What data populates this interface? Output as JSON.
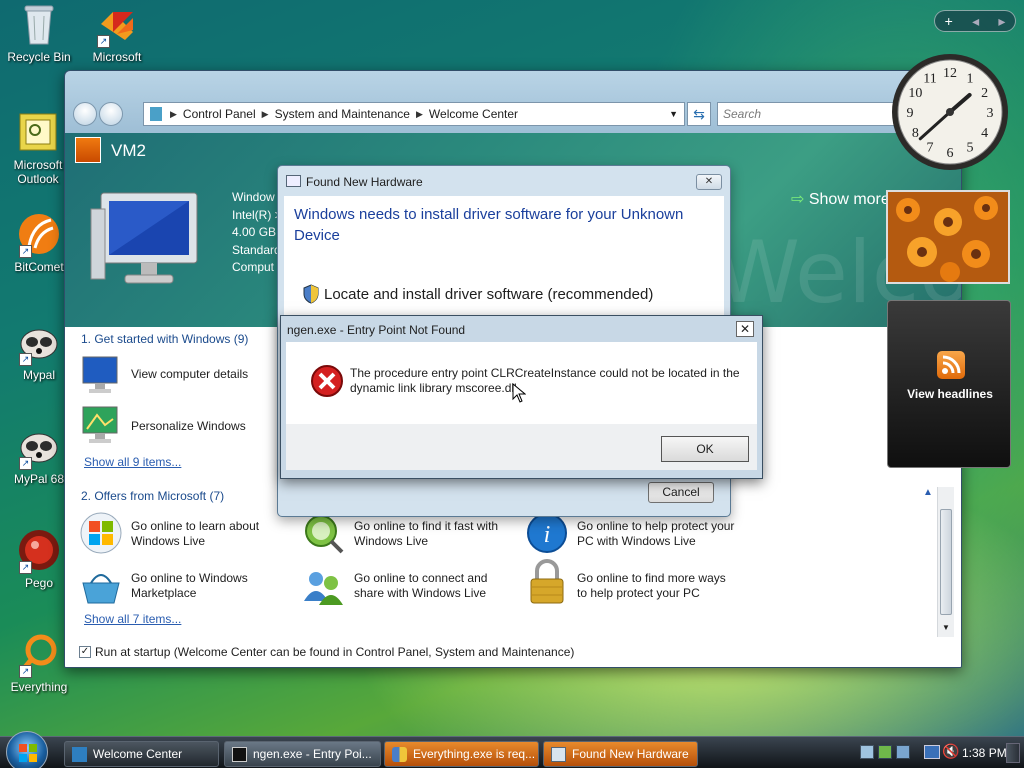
{
  "desktop": {
    "icons": [
      {
        "label": "Recycle Bin"
      },
      {
        "label": "Microsoft"
      },
      {
        "label": "Microsoft Outlook"
      },
      {
        "label": "BitComet"
      },
      {
        "label": "Mypal"
      },
      {
        "label": "MyPal 68"
      },
      {
        "label": "Pego"
      },
      {
        "label": "Everything"
      }
    ]
  },
  "window": {
    "breadcrumb": [
      "Control Panel",
      "System and Maintenance",
      "Welcome Center"
    ],
    "search_placeholder": "Search",
    "computer_name": "VM2",
    "system_info": "Window\nIntel(R) >\n4.00 GB I\nStandard\nComput",
    "show_more": "Show more",
    "banner_watermark": "Welcome",
    "section1": {
      "header": "1. Get started with Windows (9)",
      "items": [
        "View computer details",
        "Personalize Windows"
      ],
      "show_all": "Show all 9 items..."
    },
    "section2": {
      "header": "2. Offers from Microsoft (7)",
      "items": [
        "Go online to learn about Windows Live",
        "Go online to find it fast with Windows Live",
        "Go online to help protect your PC with Windows Live",
        "Go online to Windows Marketplace",
        "Go online to connect and share with Windows Live",
        "Go online to find more ways to help protect your PC"
      ],
      "show_all": "Show all 7 items..."
    },
    "startup_label": "Run at startup (Welcome Center can be found in Control Panel, System and Maintenance)",
    "startup_checked": true
  },
  "found_new_hardware": {
    "title": "Found New Hardware",
    "heading": "Windows needs to install driver software for your Unknown Device",
    "option": "Locate and install driver software (recommended)",
    "cancel": "Cancel"
  },
  "error_dialog": {
    "title": "ngen.exe - Entry Point Not Found",
    "message": "The procedure entry point CLRCreateInstance could not be located in the dynamic link library mscoree.dll.",
    "ok": "OK",
    "close": "✕"
  },
  "gadgets": {
    "feed_label": "View headlines",
    "clock_numbers": [
      "12",
      "1",
      "2",
      "3",
      "4",
      "5",
      "6",
      "7",
      "8",
      "9",
      "10",
      "11"
    ]
  },
  "taskbar": {
    "buttons": [
      {
        "label": "Welcome Center"
      },
      {
        "label": "ngen.exe - Entry Poi..."
      },
      {
        "label": "Everything.exe is req..."
      },
      {
        "label": "Found New Hardware"
      }
    ],
    "time": "1:38 PM"
  }
}
